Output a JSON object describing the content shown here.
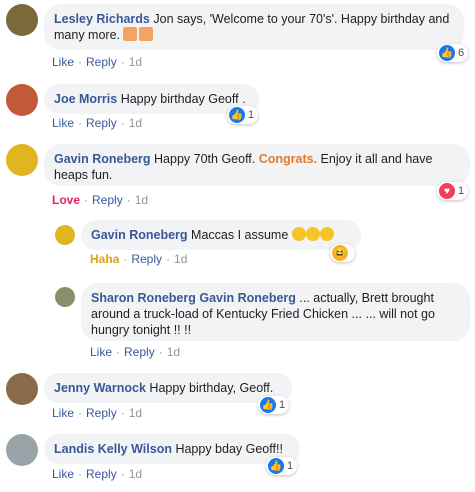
{
  "comments": [
    {
      "name": "Lesley Richards",
      "text": "Jon says, 'Welcome to your 70's'. Happy birthday and many more.",
      "actions": [
        "Like",
        "Reply"
      ],
      "time": "1d",
      "reaction": {
        "type": "like",
        "count": "6"
      }
    },
    {
      "name": "Joe Morris",
      "text": "Happy birthday Geoff .",
      "actions": [
        "Like",
        "Reply"
      ],
      "time": "1d",
      "reaction": {
        "type": "like",
        "count": "1"
      }
    },
    {
      "name": "Gavin Roneberg",
      "text_before": "Happy 70th Geoff. ",
      "highlight": "Congrats.",
      "text_after": " Enjoy it all and have heaps fun.",
      "actions": [
        "Love",
        "Reply"
      ],
      "time": "1d",
      "reaction": {
        "type": "love",
        "count": "1"
      }
    },
    {
      "name": "Gavin Roneberg",
      "text": "Maccas I assume",
      "actions": [
        "Haha",
        "Reply"
      ],
      "time": "1d",
      "reaction": {
        "type": "haha",
        "count": ""
      }
    },
    {
      "name": "Sharon Roneberg",
      "mention": "Gavin Roneberg",
      "text": " ... actually, Brett brought around a truck-load of Kentucky Fried Chicken ... ... will not go hungry tonight !! !!",
      "actions": [
        "Like",
        "Reply"
      ],
      "time": "1d"
    },
    {
      "name": "Jenny Warnock",
      "text": "Happy birthday, Geoff.",
      "actions": [
        "Like",
        "Reply"
      ],
      "time": "1d",
      "reaction": {
        "type": "like",
        "count": "1"
      }
    },
    {
      "name": "Landis Kelly Wilson",
      "text": "Happy bday Geoff!!",
      "actions": [
        "Like",
        "Reply"
      ],
      "time": "1d",
      "reaction": {
        "type": "like",
        "count": "1"
      }
    }
  ],
  "separator": "·",
  "colors": {
    "link": "#385898",
    "bubble": "#f2f3f5",
    "love": "#e0245e",
    "haha": "#e3a200",
    "like": "#1877f2"
  }
}
